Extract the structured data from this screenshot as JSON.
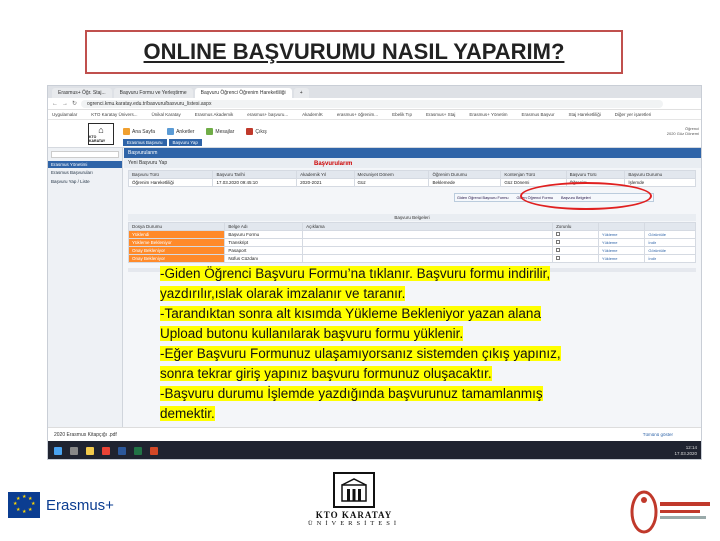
{
  "slide": {
    "title": "ONLINE BAŞVURUMU NASIL YAPARIM?"
  },
  "browser": {
    "tabs": [
      "Erasmus+ Öğr. Staj...",
      "Başvuru Formu ve Yerleştirme",
      "Başvuru Öğrenci Öğrenim Hareketliliği",
      "+"
    ],
    "url": "ogrenci.kmu.karatay.edu.tr/basvuru/basvuru_listesi.aspx",
    "bookmarks": [
      "Uygulamalar",
      "KTO Karatay Ünivers...",
      "Ünikal Karatay",
      "Erasmus Akademik",
      "erasmus+ başvuru...",
      "AkademİK",
      "erasmus+ öğrenim...",
      "Ebelik Tıp",
      "Erasmus+ Staj",
      "Erasmus+ Yönetim",
      "Erasmus Başvur",
      "Staj Hareketliliği",
      "Diğer yer işaretleri"
    ]
  },
  "app": {
    "logo_text": "KTO KARATAY",
    "toolbar": [
      "Ana Sayfa",
      "Anketler",
      "Mesajlar",
      "Çıkış"
    ],
    "user_info": [
      "Öğrenci",
      "2020 Güz Dönemi"
    ],
    "crumbs": [
      "Erasmus Başvuru",
      "Başvuru Yap"
    ],
    "sidebar_header": "Erasmus Yönetimi",
    "sidebar_items": [
      "Erasmus Başvuruları",
      "Başvuru Yap / Liste"
    ],
    "panel_title": "Başvurularım",
    "subtool_label": "Yeni Başvuru Yap",
    "red_title": "Başvurularım",
    "table1": {
      "headers": [
        "Başvuru Türü",
        "Başvuru Tarihi",
        "Akademik Yıl",
        "Mezuniyet Dönem",
        "Öğrenim Durumu",
        "Kontenjan Türü",
        "Başvuru Türü",
        "Başvuru Durumu"
      ],
      "row": [
        "Öğrenim Hareketliliği",
        "17.03.2020 09:45:10",
        "2020-2021",
        "Güz",
        "Beklemede",
        "Güz Dönemi",
        "Öğrenim",
        "İşlemde"
      ]
    },
    "popup_title": "Başvuru Formu",
    "popup_links": [
      "Giden Öğrenci Başvuru Formu",
      "Giden Öğrenci Formu",
      "Başvuru Belgeleri"
    ],
    "table2_caption": "Başvuru Belgeleri",
    "table2": {
      "headers": [
        "Dosya Durumu",
        "Belge Adı",
        "Açıklama",
        "Zorunlu",
        "",
        ""
      ],
      "rows": [
        [
          "Yüklendi",
          "Başvuru Formu",
          "",
          "",
          "Yükleme",
          "Görüntüle"
        ],
        [
          "Yükleme Bekleniyor",
          "Transkript",
          "",
          "",
          "Yükleme",
          "İndir"
        ],
        [
          "Onay Bekleniyor",
          "Pasaport",
          "",
          "",
          "Yükleme",
          "Görüntüle"
        ],
        [
          "Onay Bekleniyor",
          "Nüfus Cüzdanı",
          "",
          "",
          "Yükleme",
          "İndir"
        ]
      ]
    },
    "download_file": "2020 Erasmus Kitapçığı .pdf",
    "download_all": "Tümünü göster",
    "clock": [
      "12:14",
      "17.03.2020"
    ]
  },
  "instructions": [
    "-Giden Öğrenci Başvuru Formu’na tıklanır. Başvuru formu indirilir,",
    "yazdırılır,ıslak olarak imzalanır ve taranır.",
    "-Tarandıktan sonra alt kısımda Yükleme Bekleniyor yazan alana",
    "Upload butonu kullanılarak başvuru formu yüklenir.",
    "-Eğer Başvuru Formunuz ulaşamıyorsanız sistemden çıkış yapınız,",
    "sonra tekrar giriş yapınız başvuru formunuz oluşacaktır.",
    "-Başvuru durumu İşlemde yazdığında başvurunuz tamamlanmış",
    "demektir."
  ],
  "footer": {
    "erasmus_text": "Erasmus+",
    "ktu_name": "KTO KARATAY",
    "ktu_sub": "ÜNİVERSİTESİ"
  },
  "colors": {
    "highlight": "#ffff00",
    "accent": "#2f64a8",
    "alert": "#e02020",
    "warning_cell": "#ff8a2a"
  }
}
